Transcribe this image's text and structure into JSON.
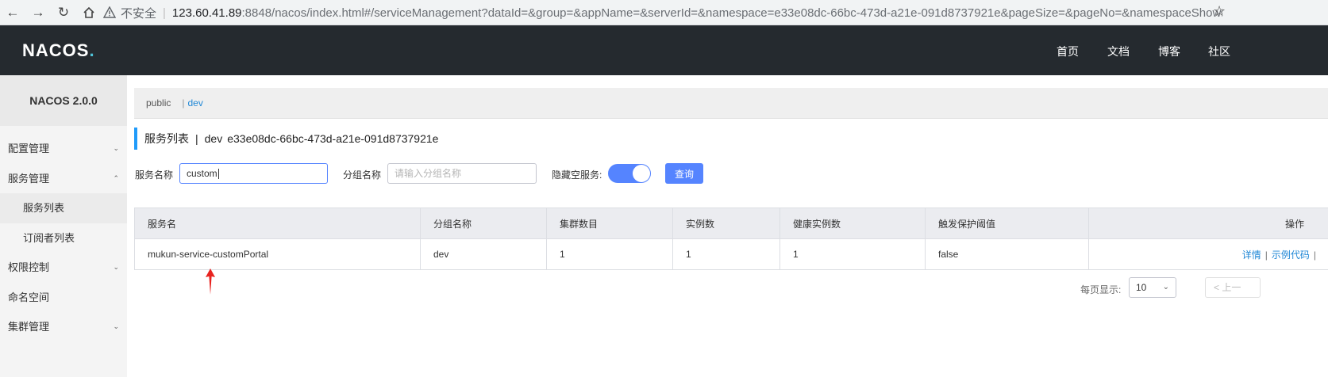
{
  "browser": {
    "insecure": "不安全",
    "host": "123.60.41.89",
    "path": ":8848/nacos/index.html#/serviceManagement?dataId=&group=&appName=&serverId=&namespace=e33e08dc-66bc-473d-a21e-091d8737921e&pageSize=&pageNo=&namespaceShowNam..."
  },
  "header": {
    "logo_text": "NACOS",
    "logo_dot": ".",
    "nav": [
      "首页",
      "文档",
      "博客",
      "社区"
    ]
  },
  "sidebar": {
    "version": "NACOS 2.0.0",
    "items": [
      {
        "label": "配置管理"
      },
      {
        "label": "服务管理"
      },
      {
        "label": "服务列表"
      },
      {
        "label": "订阅者列表"
      },
      {
        "label": "权限控制"
      },
      {
        "label": "命名空间"
      },
      {
        "label": "集群管理"
      }
    ]
  },
  "namespaces": {
    "public": "public",
    "separator": "|",
    "dev": "dev"
  },
  "page_title": {
    "title": "服务列表",
    "separator": "|",
    "namespace_name": "dev",
    "namespace_id": "e33e08dc-66bc-473d-a21e-091d8737921e"
  },
  "filters": {
    "service_name_label": "服务名称",
    "service_name_value": "custom",
    "group_name_label": "分组名称",
    "group_name_placeholder": "请输入分组名称",
    "hide_empty_label": "隐藏空服务:",
    "hide_empty_on": true,
    "query_button": "查询"
  },
  "table": {
    "headers": [
      "服务名",
      "分组名称",
      "集群数目",
      "实例数",
      "健康实例数",
      "触发保护阈值",
      "操作"
    ],
    "rows": [
      {
        "service": "mukun-service-customPortal",
        "group": "dev",
        "clusters": "1",
        "instances": "1",
        "healthy": "1",
        "threshold": "false",
        "op_detail": "详情",
        "op_sample": "示例代码",
        "op_sep": "|"
      }
    ]
  },
  "pagination": {
    "page_size_label": "每页显示:",
    "page_size": "10",
    "prev": "< 上一"
  },
  "colors": {
    "header_bg": "#252a2f",
    "primary": "#5584ff",
    "link": "#1f87d6",
    "annotation_arrow": "#e8231f"
  }
}
